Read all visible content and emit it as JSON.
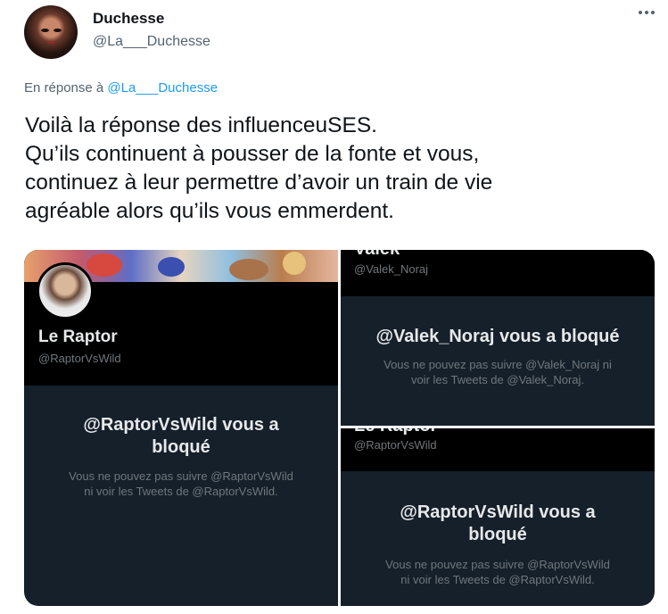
{
  "author": {
    "name": "Duchesse",
    "handle": "@La___Duchesse"
  },
  "reply": {
    "prefix": "En réponse à",
    "to": "@La___Duchesse"
  },
  "tweet_text": {
    "line1": "Voilà la réponse des influenceuSES.",
    "line2": "Qu’ils continuent à pousser de la fonte et vous,",
    "line3": "continuez à leur permettre d’avoir un train de vie",
    "line4": "agréable alors qu’ils vous emmerdent."
  },
  "media": {
    "left": {
      "name": "Le Raptor",
      "handle": "@RaptorVsWild",
      "block_title_line1": "@RaptorVsWild vous a",
      "block_title_line2": "bloqué",
      "block_sub_line1": "Vous ne pouvez pas suivre @RaptorVsWild",
      "block_sub_line2": "ni voir les Tweets de @RaptorVsWild."
    },
    "right_top": {
      "cut_name": "Valek",
      "handle": "@Valek_Noraj",
      "block_title": "@Valek_Noraj vous a bloqué",
      "block_sub_line1": "Vous ne pouvez pas suivre @Valek_Noraj ni",
      "block_sub_line2": "voir les Tweets de @Valek_Noraj."
    },
    "right_bottom": {
      "cut_name": "Le Raptor",
      "handle": "@RaptorVsWild",
      "block_title_line1": "@RaptorVsWild vous a",
      "block_title_line2": "bloqué",
      "block_sub_line1": "Vous ne pouvez pas suivre @RaptorVsWild",
      "block_sub_line2": "ni voir les Tweets de @RaptorVsWild."
    }
  },
  "icons": {
    "more": "more-options-icon"
  },
  "colors": {
    "link": "#1d9bf0",
    "secondary_text": "#536471",
    "dark_bg": "#15202b"
  }
}
